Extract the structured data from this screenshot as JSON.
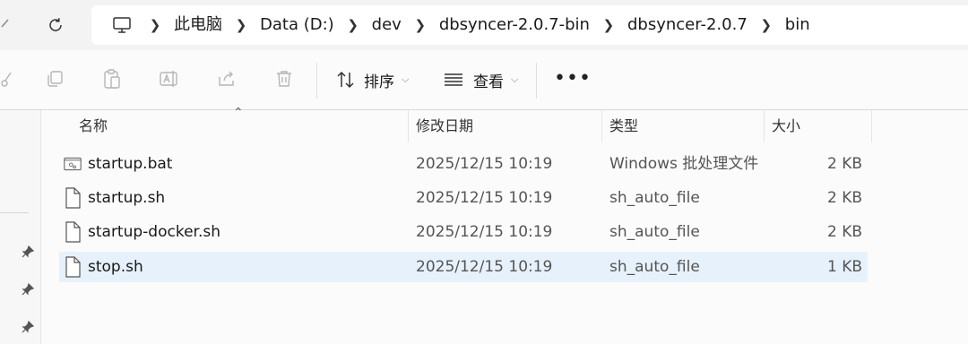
{
  "address": {
    "segments": [
      "此电脑",
      "Data (D:)",
      "dev",
      "dbsyncer-2.0.7-bin",
      "dbsyncer-2.0.7",
      "bin"
    ]
  },
  "toolbar": {
    "sort_label": "排序",
    "view_label": "查看",
    "more_label": "•••"
  },
  "columns": {
    "name": "名称",
    "date": "修改日期",
    "type": "类型",
    "size": "大小"
  },
  "files": [
    {
      "name": "startup.bat",
      "date": "2025/12/15 10:19",
      "type": "Windows 批处理文件",
      "size": "2 KB",
      "icon": "batch-file-icon",
      "selected": false
    },
    {
      "name": "startup.sh",
      "date": "2025/12/15 10:19",
      "type": "sh_auto_file",
      "size": "2 KB",
      "icon": "file-icon",
      "selected": false
    },
    {
      "name": "startup-docker.sh",
      "date": "2025/12/15 10:19",
      "type": "sh_auto_file",
      "size": "2 KB",
      "icon": "file-icon",
      "selected": false
    },
    {
      "name": "stop.sh",
      "date": "2025/12/15 10:19",
      "type": "sh_auto_file",
      "size": "1 KB",
      "icon": "file-icon",
      "selected": true
    }
  ],
  "colors": {
    "selection": "#e6f1fb",
    "address_bar_bg": "#f3f3f3"
  }
}
